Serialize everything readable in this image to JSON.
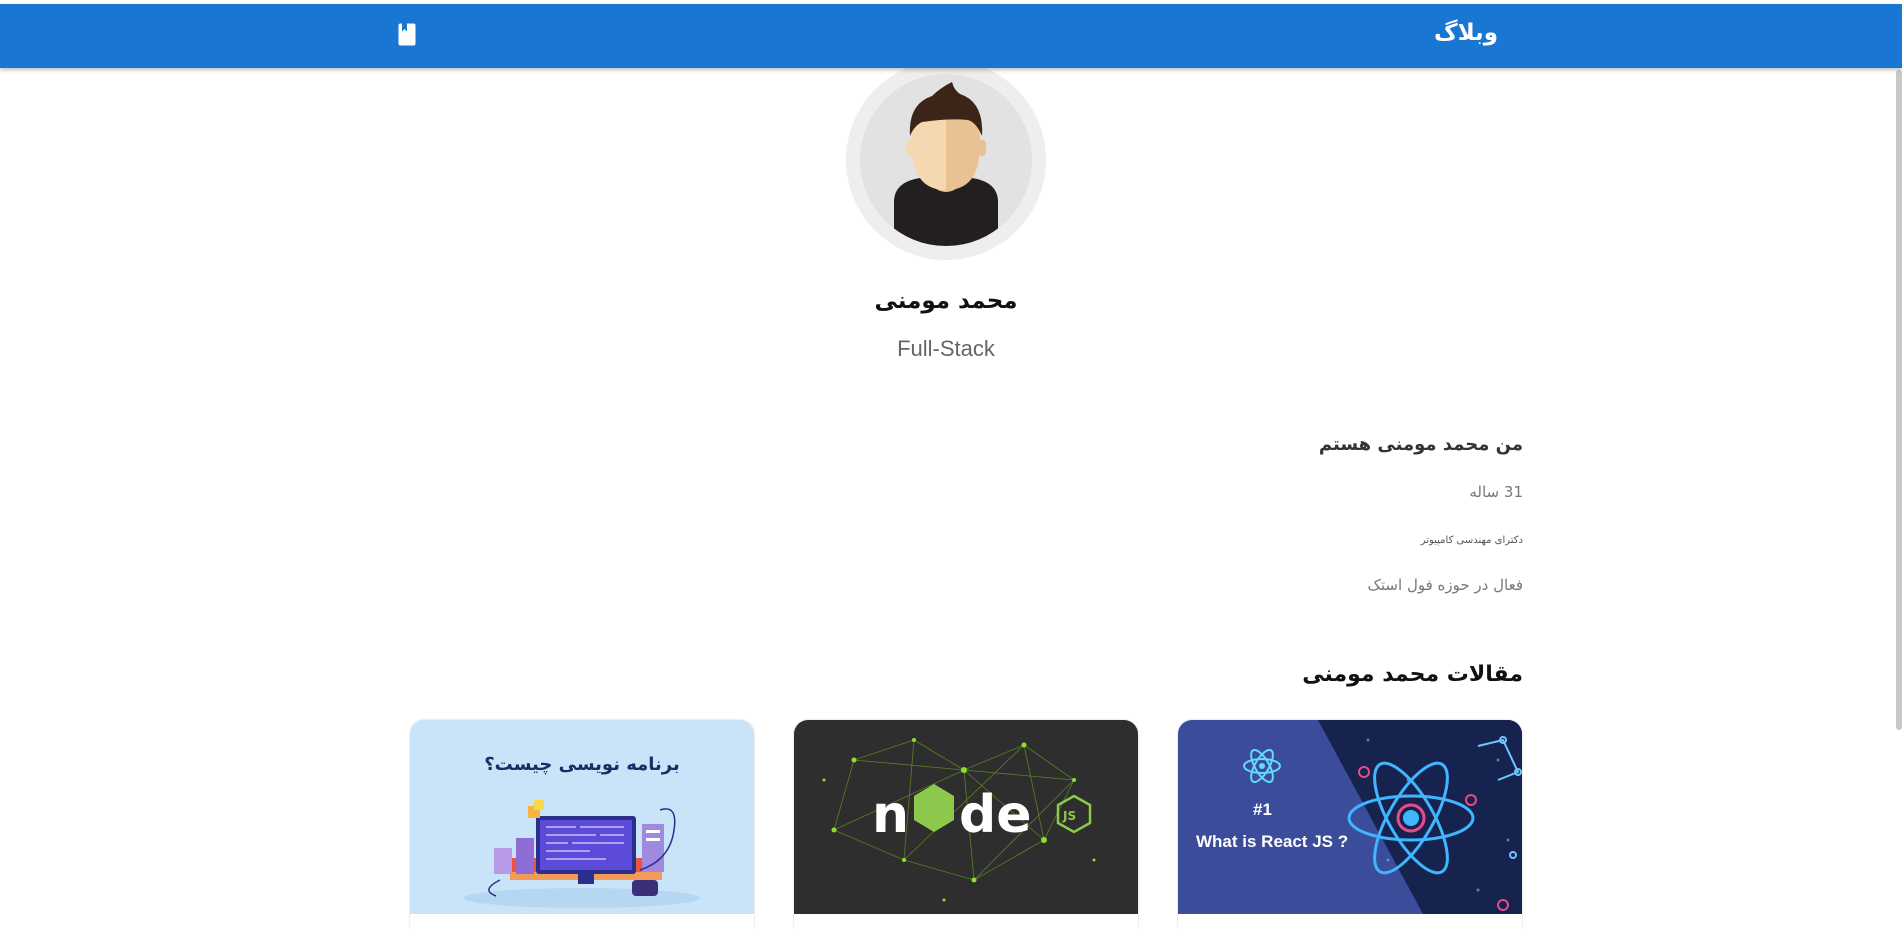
{
  "header": {
    "brand": "وبلاگ",
    "icon": "book-icon",
    "color": "#1976d2"
  },
  "profile": {
    "name": "محمد مومنی",
    "role": "Full-Stack",
    "avatar_icon": "user-avatar"
  },
  "about": {
    "title": "من محمد مومنی هستم",
    "age": "31 ساله",
    "degree": "دکترای مهندسی کامپیوتر",
    "field": "فعال در حوزه فول استک"
  },
  "articles": {
    "heading": "مقالات محمد مومنی",
    "cards": [
      {
        "image": "react-illustration",
        "number": "#1",
        "image_text": "What is React JS ?"
      },
      {
        "image": "nodejs-illustration",
        "logo_text": "node",
        "badge_text": "JS"
      },
      {
        "image": "programming-illustration",
        "image_text": "برنامه نویسی چیست؟"
      }
    ]
  }
}
